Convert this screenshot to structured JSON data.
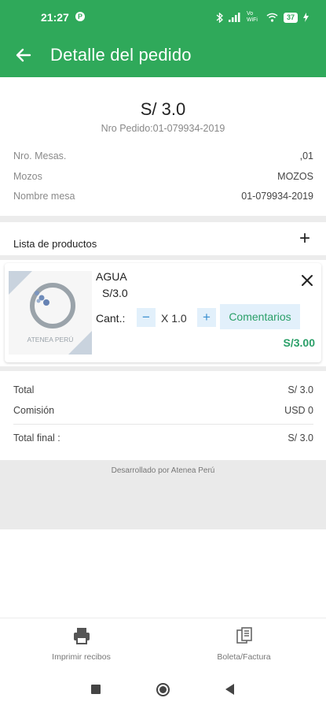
{
  "status_bar": {
    "time": "21:27",
    "notification_icon": "p-badge",
    "network_text": "Vo WiFi",
    "battery": "37",
    "icons": [
      "bluetooth-icon",
      "signal-icon",
      "wifi-icon",
      "battery-icon",
      "charging-icon"
    ]
  },
  "app_bar": {
    "title": "Detalle del pedido",
    "back_icon": "arrow-left-icon",
    "background_color": "#2fa95a"
  },
  "order": {
    "amount": "S/ 3.0",
    "order_number": "Nro Pedido:01-079934-2019",
    "info": [
      {
        "label": "Nro. Mesas.",
        "value": ",01"
      },
      {
        "label": "Mozos",
        "value": "MOZOS"
      },
      {
        "label": "Nombre mesa",
        "value": "01-079934-2019"
      }
    ]
  },
  "products": {
    "header": "Lista de productos",
    "add_label": "+",
    "items": [
      {
        "name": "AGUA",
        "unit_price": "S/3.0",
        "qty_label": "Cant.:",
        "qty_value": "X 1.0",
        "minus_label": "−",
        "plus_label": "+",
        "comments_label": "Comentarios",
        "total": "S/3.00",
        "image_caption": "ATENEA PERÚ"
      }
    ]
  },
  "summary": [
    {
      "label": "Total",
      "value": "S/ 3.0"
    },
    {
      "label": "Comisión",
      "value": "USD 0"
    },
    {
      "label": "Total final :",
      "value": "S/ 3.0"
    }
  ],
  "footer": {
    "credits": "Desarrollado por Atenea Perú"
  },
  "bottom_actions": [
    {
      "label": "Imprimir recibos",
      "icon": "printer-icon"
    },
    {
      "label": "Boleta/Factura",
      "icon": "documents-icon"
    }
  ],
  "colors": {
    "primary": "#2fa95a",
    "price_green": "#2a9f68",
    "button_bg": "#e2f0fb",
    "button_fg": "#3a8fd0"
  }
}
